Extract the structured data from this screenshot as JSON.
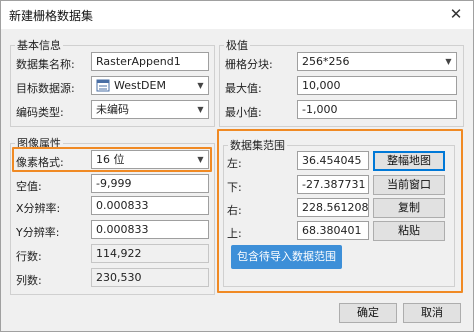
{
  "window": {
    "title": "新建栅格数据集",
    "close_symbol": "✕"
  },
  "basic": {
    "legend": "基本信息",
    "name_label": "数据集名称:",
    "name_value": "RasterAppend1",
    "target_label": "目标数据源:",
    "target_value": "WestDEM",
    "target_icon": "database-icon",
    "encoding_label": "编码类型:",
    "encoding_value": "未编码"
  },
  "extreme": {
    "legend": "极值",
    "tile_label": "栅格分块:",
    "tile_value": "256*256",
    "max_label": "最大值:",
    "max_value": "10,000",
    "min_label": "最小值:",
    "min_value": "-1,000"
  },
  "image": {
    "legend": "图像属性",
    "pixel_label": "像素格式:",
    "pixel_value": "16 位",
    "null_label": "空值:",
    "null_value": "-9,999",
    "xres_label": "X分辨率:",
    "xres_value": "0.000833",
    "yres_label": "Y分辨率:",
    "yres_value": "0.000833",
    "rows_label": "行数:",
    "rows_value": "114,922",
    "cols_label": "列数:",
    "cols_value": "230,530"
  },
  "bounds": {
    "legend": "数据集范围",
    "left_label": "左:",
    "left_value": "36.454045",
    "bottom_label": "下:",
    "bottom_value": "-27.387731",
    "right_label": "右:",
    "right_value": "228.561208",
    "top_label": "上:",
    "top_value": "68.380401",
    "btn_full": "整幅地图",
    "btn_current": "当前窗口",
    "btn_copy": "复制",
    "btn_paste": "粘贴",
    "callout": "包含待导入数据范围"
  },
  "footer": {
    "ok": "确定",
    "cancel": "取消"
  },
  "colors": {
    "highlight": "#f08a24",
    "callout_bg": "#3d8fd8",
    "focus": "#0078d7"
  }
}
